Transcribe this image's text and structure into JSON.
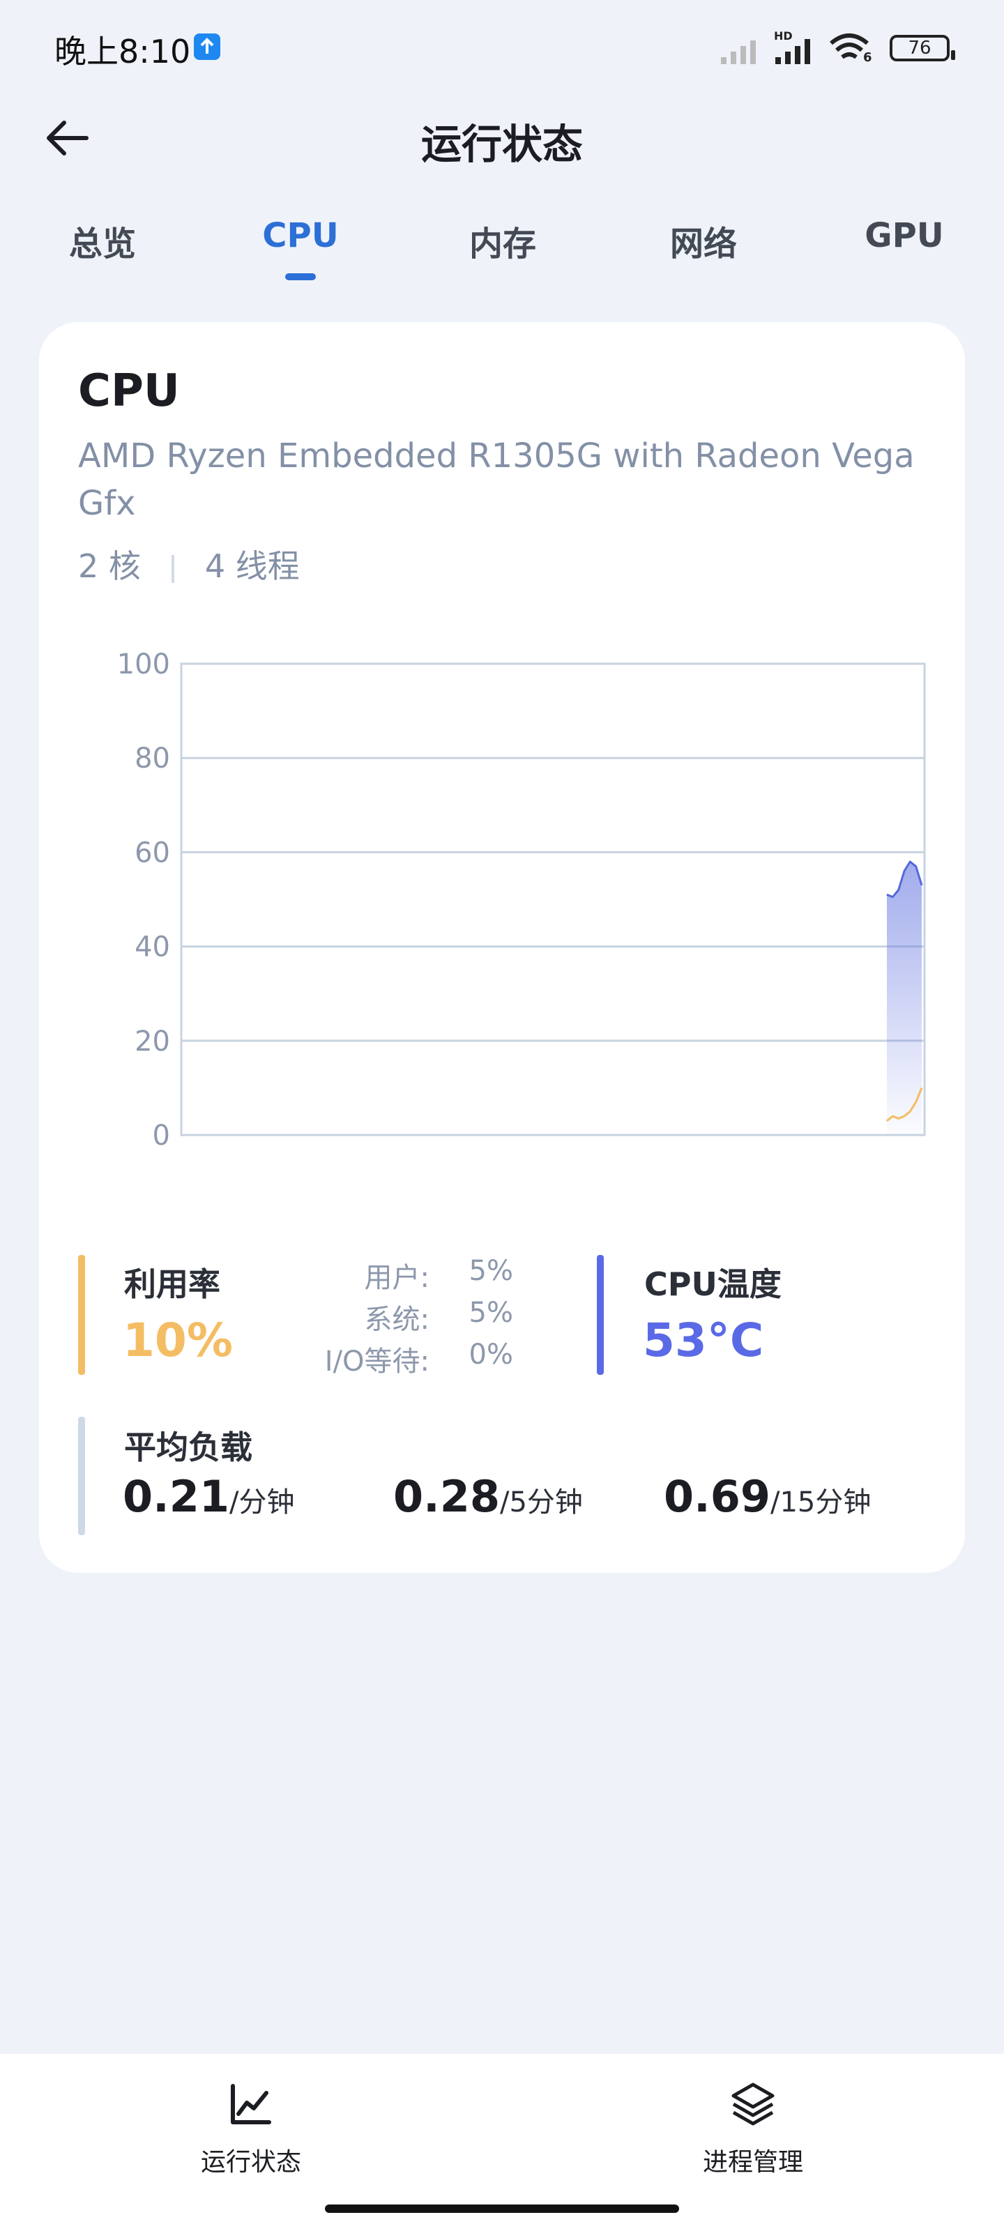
{
  "status_bar": {
    "time": "晚上8:10",
    "battery": "76",
    "signal_label": "HD",
    "wifi_label": "6"
  },
  "header": {
    "title": "运行状态"
  },
  "tabs": [
    {
      "label": "总览"
    },
    {
      "label": "CPU",
      "active": true
    },
    {
      "label": "内存"
    },
    {
      "label": "网络"
    },
    {
      "label": "GPU"
    }
  ],
  "cpu": {
    "title": "CPU",
    "model": "AMD Ryzen Embedded R1305G with Radeon Vega Gfx",
    "cores": "2 核",
    "threads": "4 线程"
  },
  "chart_data": {
    "type": "area",
    "ylim": [
      0,
      100
    ],
    "yticks": [
      "100",
      "80",
      "60",
      "40",
      "20",
      "0"
    ],
    "grid": true,
    "series": [
      {
        "color": "#5568dd",
        "values": [
          51,
          50.5,
          52,
          56,
          58,
          57,
          53
        ]
      },
      {
        "color": "#f4bd63",
        "values": [
          3,
          4,
          3.5,
          4,
          5,
          7,
          10
        ]
      }
    ]
  },
  "stats": {
    "utilization_label": "利用率",
    "utilization_value": "10%",
    "user_label": "用户:",
    "user_value": "5%",
    "system_label": "系统:",
    "system_value": "5%",
    "io_label": "I/O等待:",
    "io_value": "0%",
    "temp_label": "CPU温度",
    "temp_value": "53°C",
    "load_label": "平均负载",
    "load_1": "0.21",
    "load_1_unit": "/分钟",
    "load_5": "0.28",
    "load_5_unit": "/5分钟",
    "load_15": "0.69",
    "load_15_unit": "/15分钟"
  },
  "colors": {
    "accent": "#2c6fd6",
    "utilization": "#f4bd63",
    "temperature": "#5a6ae6",
    "load_bar": "#cfd8e6"
  },
  "bottom_nav": [
    {
      "label": "运行状态",
      "icon": "chart-line-icon"
    },
    {
      "label": "进程管理",
      "icon": "layers-icon"
    }
  ]
}
